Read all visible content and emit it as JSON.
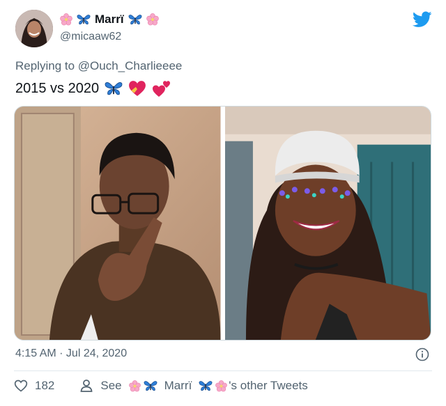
{
  "user": {
    "display_name": "Marrï",
    "handle": "@micaaw62"
  },
  "reply": {
    "prefix": "Replying to",
    "mention": "@Ouch_Charlieeee"
  },
  "tweet": {
    "text": "2015 vs 2020",
    "emojis": [
      "butterfly",
      "heart-with-ribbon",
      "two-hearts"
    ],
    "timestamp": "4:15 AM · Jul 24, 2020"
  },
  "actions": {
    "like_count": "182",
    "see_prefix": "See",
    "see_name": "Marrï",
    "see_suffix": "'s other Tweets"
  },
  "colors": {
    "twitter_blue": "#1d9bf0",
    "secondary_text": "#536471",
    "butterfly_blue": "#2f7fd8",
    "blossom_pink": "#f7a8c8",
    "heart_red": "#e0245e"
  },
  "icons": [
    "bird-logo-icon",
    "info-icon",
    "heart-icon",
    "person-icon",
    "cherry-blossom-icon",
    "butterfly-icon"
  ]
}
